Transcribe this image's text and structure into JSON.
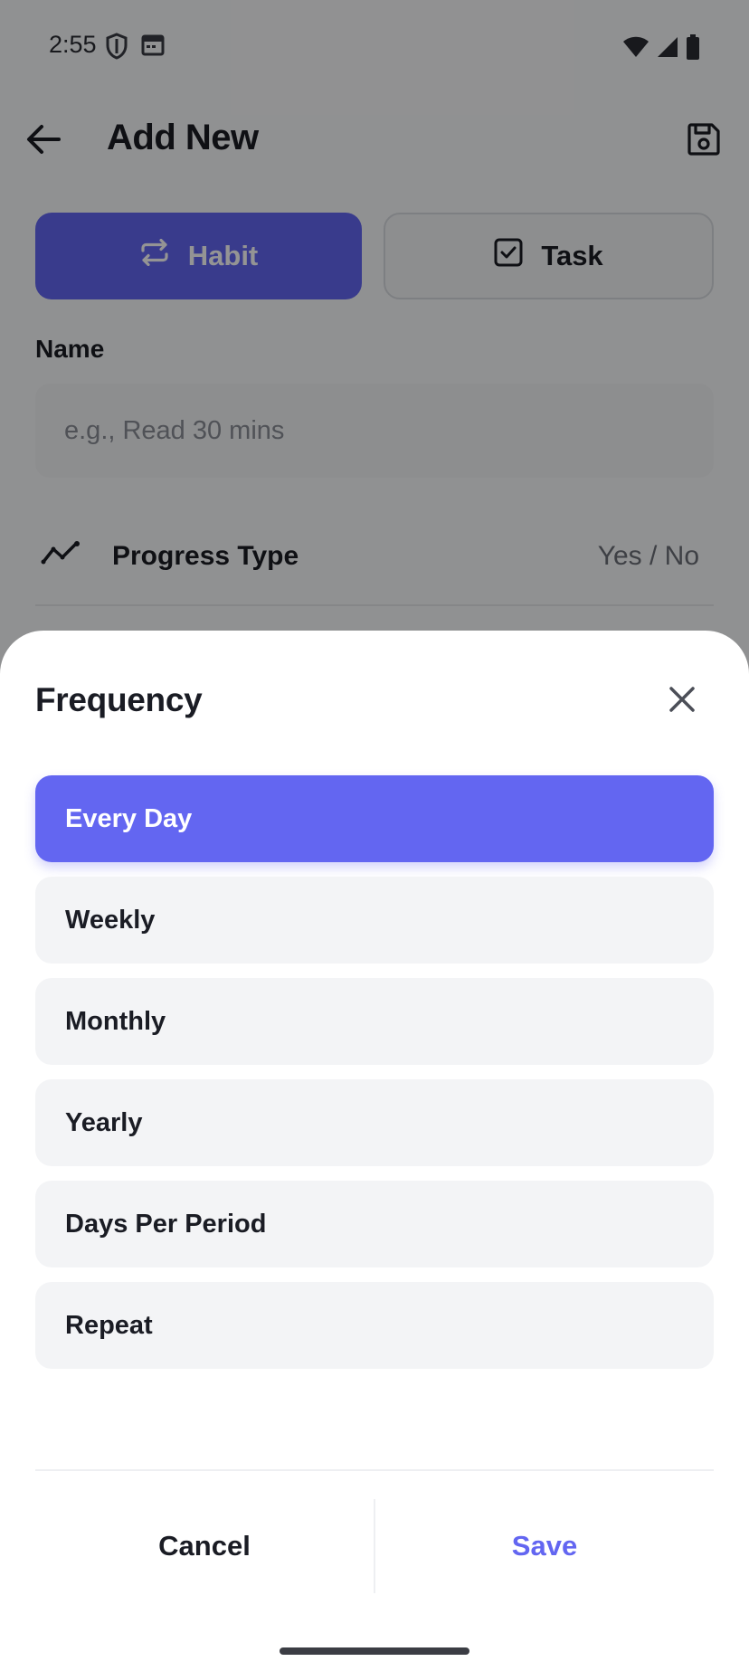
{
  "status_bar": {
    "time": "2:55",
    "left_icons": [
      "shield-icon",
      "calendar-icon"
    ],
    "right_icons": [
      "wifi-icon",
      "signal-icon",
      "battery-icon"
    ]
  },
  "app_bar": {
    "title": "Add New",
    "back_icon": "arrow-left-icon",
    "save_icon": "floppy-disk-icon"
  },
  "type_toggle": {
    "habit_label": "Habit",
    "task_label": "Task",
    "selected": "Habit"
  },
  "name_field": {
    "label": "Name",
    "placeholder": "e.g., Read 30 mins",
    "value": ""
  },
  "progress_type": {
    "label": "Progress Type",
    "value": "Yes / No",
    "icon": "trend-line-icon"
  },
  "frequency_sheet": {
    "title": "Frequency",
    "close_icon": "close-icon",
    "options": [
      {
        "label": "Every Day",
        "selected": true
      },
      {
        "label": "Weekly",
        "selected": false
      },
      {
        "label": "Monthly",
        "selected": false
      },
      {
        "label": "Yearly",
        "selected": false
      },
      {
        "label": "Days Per Period",
        "selected": false
      },
      {
        "label": "Repeat",
        "selected": false
      }
    ],
    "cancel_label": "Cancel",
    "save_label": "Save"
  },
  "colors": {
    "accent": "#6366f1",
    "text_primary": "#1a1c24",
    "surface": "#f3f4f6"
  }
}
